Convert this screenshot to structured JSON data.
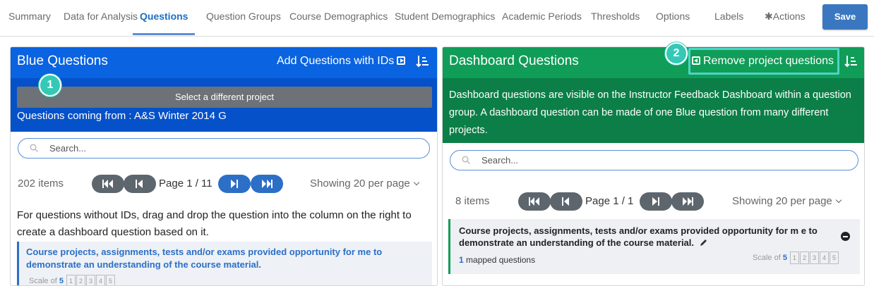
{
  "nav": {
    "tabs": [
      {
        "label": "Summary"
      },
      {
        "label": "Data for Analysis"
      },
      {
        "label": "Questions"
      },
      {
        "label": "Question Groups"
      },
      {
        "label": "Course Demographics"
      },
      {
        "label": "Student Demographics"
      },
      {
        "label": "Academic Periods"
      },
      {
        "label": "Thresholds"
      },
      {
        "label": "Options"
      },
      {
        "label": "Labels"
      },
      {
        "label": "✱Actions"
      }
    ],
    "active_tab": "Questions",
    "save_label": "Save"
  },
  "blue_panel": {
    "title": "Blue Questions",
    "add_action": "Add Questions with IDs",
    "select_project": "Select a different project",
    "coming_from": "Questions coming from : A&S Winter 2014 G",
    "search_placeholder": "Search...",
    "items_count": "202 items",
    "page_text": "Page 1 / 11",
    "per_page": "Showing 20 per page",
    "hint": "For questions without IDs, drag and drop the question into the column on the right to create a dashboard question based on it.",
    "card": {
      "text": "Course projects, assignments, tests and/or exams provided opportunity for me to demonstrate an understanding of the course material.",
      "scale_label": "Scale of",
      "scale_value": "5",
      "scale_points": [
        "1",
        "2",
        "3",
        "4",
        "5"
      ]
    }
  },
  "green_panel": {
    "title": "Dashboard Questions",
    "remove_action": "Remove project questions",
    "description": "Dashboard questions are visible on the Instructor Feedback Dashboard within a question group. A dashboard question can be made of one Blue question from many different projects.",
    "search_placeholder": "Search...",
    "items_count": "8 items",
    "page_text": "Page 1 / 1",
    "per_page": "Showing 20 per page",
    "card": {
      "text": "Course projects, assignments, tests and/or exams provided opportunity for m e to demonstrate an understanding of the course material.",
      "mapped_count": "1",
      "mapped_label": "mapped questions",
      "scale_label": "Scale of",
      "scale_value": "5",
      "scale_points": [
        "1",
        "2",
        "3",
        "4",
        "5"
      ]
    }
  },
  "callouts": [
    "1",
    "2"
  ],
  "colors": {
    "blue_header": "#0a63e0",
    "green_header": "#0f9d58",
    "callout": "#35c9b5",
    "save": "#3a77c0"
  }
}
